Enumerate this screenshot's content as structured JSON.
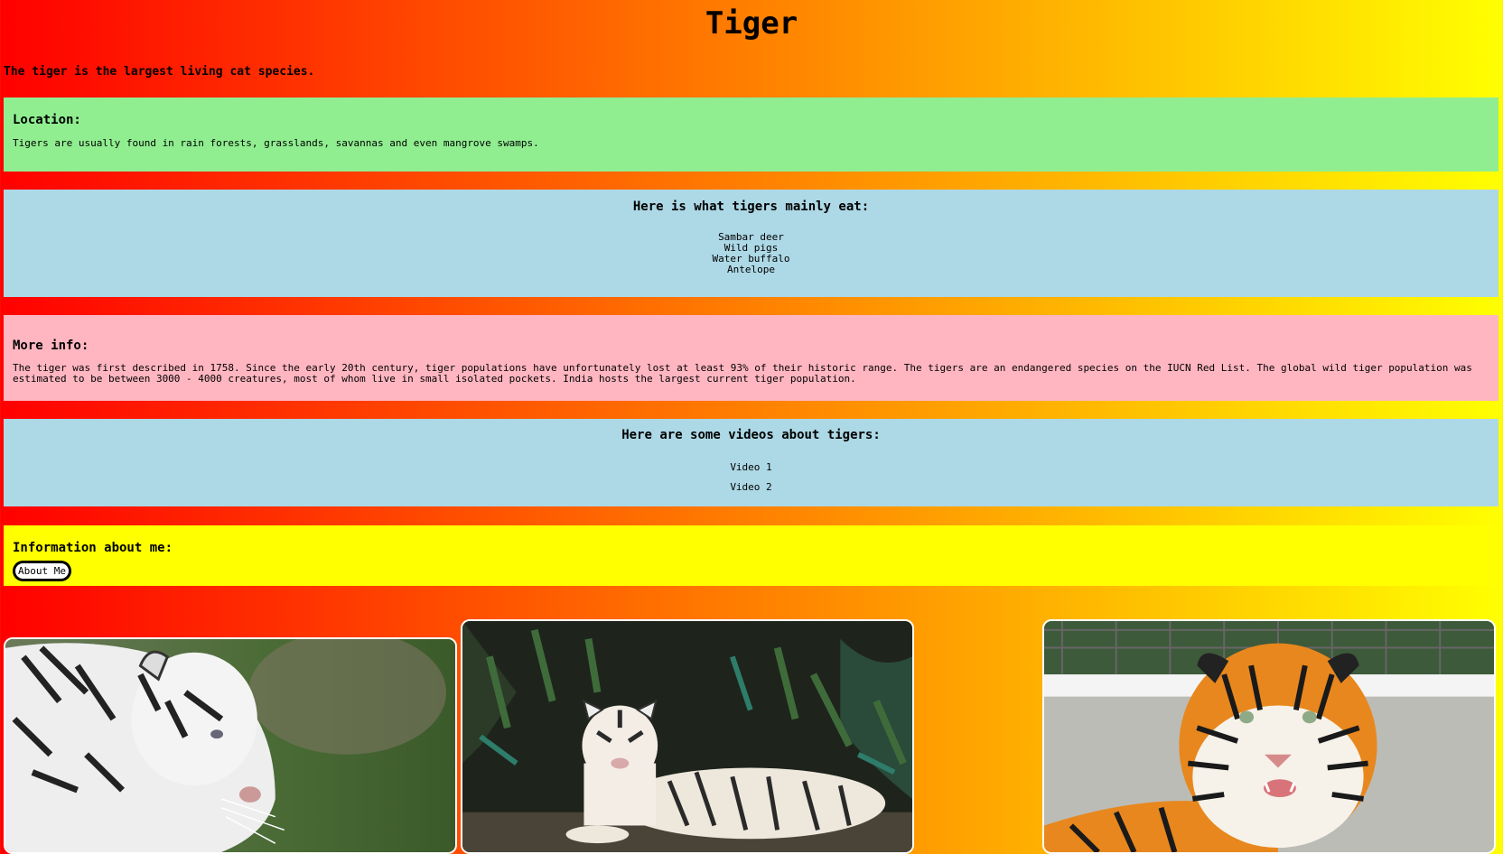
{
  "page": {
    "title": "Tiger",
    "intro": "The tiger is the largest living cat species."
  },
  "location": {
    "heading": "Location:",
    "text": "Tigers are usually found in rain forests, grasslands, savannas and even mangrove swamps."
  },
  "diet": {
    "heading": "Here is what tigers mainly eat:",
    "items": [
      "Sambar deer",
      "Wild pigs",
      "Water buffalo",
      "Antelope"
    ]
  },
  "more_info": {
    "heading": "More info:",
    "text": "The tiger was first described in 1758. Since the early 20th century, tiger populations have unfortunately lost at least 93% of their historic range. The tigers are an endangered species on the IUCN Red List. The global wild tiger population was estimated to be between 3000 - 4000 creatures, most of whom live in small isolated pockets. India hosts the largest current tiger population."
  },
  "videos": {
    "heading": "Here are some videos about tigers:",
    "links": [
      "Video 1",
      "Video 2"
    ]
  },
  "about": {
    "heading": "Information about me:",
    "button_label": "About Me"
  },
  "colors": {
    "gradient_start": "#ff0000",
    "gradient_end": "#ffff00",
    "location_bg": "#90ee90",
    "diet_bg": "#add8e6",
    "more_info_bg": "#ffb6c1",
    "about_bg": "#ffff00"
  },
  "images": [
    {
      "name": "white-tiger-profile-photo"
    },
    {
      "name": "white-tiger-lying-photo"
    },
    {
      "name": "bengal-tiger-face-photo"
    }
  ]
}
